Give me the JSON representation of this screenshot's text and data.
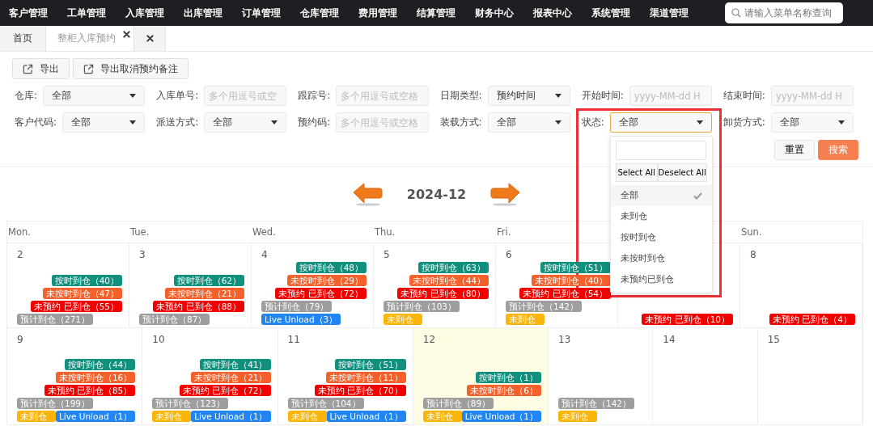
{
  "nav": {
    "items": [
      "客户管理",
      "工单管理",
      "入库管理",
      "出库管理",
      "订单管理",
      "仓库管理",
      "费用管理",
      "结算管理",
      "财务中心",
      "报表中心",
      "系统管理",
      "渠道管理"
    ],
    "search": {
      "placeholder": "请输入菜单名称查询"
    }
  },
  "tabs": [
    {
      "kind": "page",
      "label": "首页",
      "selected": false,
      "closable": false
    },
    {
      "kind": "page",
      "label": "整柜入库预约",
      "selected": true,
      "closable": true
    },
    {
      "kind": "close-all",
      "selected": false
    }
  ],
  "toolbar": [
    {
      "label": "导出"
    },
    {
      "label": "导出取消预约备注"
    }
  ],
  "filters": [
    [
      {
        "label": "仓库:",
        "kind": "select",
        "value": "全部",
        "focused": false
      },
      {
        "label": "入库单号:",
        "kind": "input",
        "placeholder": "多个用逗号或空",
        "focused": false
      },
      {
        "label": "跟踪号:",
        "kind": "input",
        "placeholder": "多个用逗号或空格",
        "focused": false
      },
      {
        "label": "日期类型:",
        "kind": "select",
        "value": "预约时间",
        "focused": false
      },
      {
        "label": "开始时间:",
        "kind": "input",
        "placeholder": "yyyy-MM-dd H",
        "focused": false
      },
      {
        "label": "结束时间:",
        "kind": "input",
        "placeholder": "yyyy-MM-dd H",
        "focused": false
      }
    ],
    [
      {
        "label": "客户代码:",
        "kind": "select",
        "value": "全部",
        "focused": false
      },
      {
        "label": "派送方式:",
        "kind": "select",
        "value": "全部",
        "focused": false
      },
      {
        "label": "预约码:",
        "kind": "input",
        "placeholder": "多个用逗号或空格",
        "focused": false
      },
      {
        "label": "装载方式:",
        "kind": "select",
        "value": "全部",
        "focused": false
      },
      {
        "label": "状态:",
        "kind": "select",
        "value": "全部",
        "focused": true
      },
      {
        "label": "卸货方式:",
        "kind": "select",
        "value": "全部",
        "focused": false
      }
    ]
  ],
  "actions": [
    {
      "label": "重置",
      "kind": "default"
    },
    {
      "label": "搜索",
      "kind": "primary"
    }
  ],
  "status_dropdown": {
    "actions": [
      "Select All",
      "Deselect All"
    ],
    "options": [
      {
        "label": "全部",
        "selected": true
      },
      {
        "label": "未到仓",
        "selected": false
      },
      {
        "label": "按时到仓",
        "selected": false
      },
      {
        "label": "未按时到仓",
        "selected": false
      },
      {
        "label": "未预约已到仓",
        "selected": false
      }
    ]
  },
  "calendar": {
    "title": "2024-12",
    "weekdays": {
      "mon": "Mon.",
      "tue": "Tue.",
      "wed": "Wed.",
      "thu": "Thu.",
      "fri": "Fri.",
      "sun": "Sun."
    },
    "weeks": [
      [
        {
          "day": "2",
          "today": false,
          "events": [
            {
              "kind": "ontime",
              "label": "按时到仓（40）"
            },
            {
              "kind": "late",
              "label": "未按时到仓（47）"
            },
            {
              "kind": "unscheduled",
              "label": "未预约 已到仓（55）"
            },
            {
              "kind": "expected",
              "label": "预计到仓（271）"
            }
          ]
        },
        {
          "day": "3",
          "today": false,
          "events": [
            {
              "kind": "ontime",
              "label": "按时到仓（62）"
            },
            {
              "kind": "late",
              "label": "未按时到仓（21）"
            },
            {
              "kind": "unscheduled",
              "label": "未预约 已到仓（88）"
            },
            {
              "kind": "expected",
              "label": "预计到仓（87）"
            }
          ]
        },
        {
          "day": "4",
          "today": false,
          "events": [
            {
              "kind": "ontime",
              "label": "按时到仓（48）"
            },
            {
              "kind": "late",
              "label": "未按时到仓（29）"
            },
            {
              "kind": "unscheduled",
              "label": "未预约 已到仓（72）"
            },
            {
              "kind": "expected",
              "label": "预计到仓（79）"
            },
            {
              "kind": "live",
              "label": "Live Unload（3）"
            }
          ]
        },
        {
          "day": "5",
          "today": false,
          "events": [
            {
              "kind": "ontime",
              "label": "按时到仓（63）"
            },
            {
              "kind": "late",
              "label": "未按时到仓（44）"
            },
            {
              "kind": "unscheduled",
              "label": "未预约 已到仓（80）"
            },
            {
              "kind": "expected",
              "label": "预计到仓（103）"
            },
            {
              "kind": "notarrived",
              "label": "未到仓"
            }
          ]
        },
        {
          "day": "6",
          "today": false,
          "events": [
            {
              "kind": "ontime",
              "label": "按时到仓（51）"
            },
            {
              "kind": "late",
              "label": "未按时到仓（40）"
            },
            {
              "kind": "unscheduled",
              "label": "未预约 已到仓（54）"
            },
            {
              "kind": "expected",
              "label": "预计到仓（142）"
            },
            {
              "kind": "notarrived",
              "label": "未到仓"
            }
          ]
        },
        {
          "today": false,
          "events": [
            {
              "kind": "unscheduled",
              "label": "未预约 已到仓（10）"
            }
          ]
        },
        {
          "day": "8",
          "today": false,
          "events": [
            {
              "kind": "unscheduled",
              "label": "未预约 已到仓（4）"
            }
          ]
        }
      ],
      [
        {
          "day": "9",
          "today": false,
          "events": [
            {
              "kind": "ontime",
              "label": "按时到仓（44）"
            },
            {
              "kind": "late",
              "label": "未按时到仓（16）"
            },
            {
              "kind": "unscheduled",
              "label": "未预约 已到仓（85）"
            },
            {
              "kind": "expected",
              "label": "预计到仓（199）"
            },
            {
              "kind": "notarrived",
              "label": "未到仓"
            },
            {
              "kind": "live",
              "label": "Live Unload（1）"
            }
          ]
        },
        {
          "day": "10",
          "today": false,
          "events": [
            {
              "kind": "ontime",
              "label": "按时到仓（41）"
            },
            {
              "kind": "late",
              "label": "未按时到仓（21）"
            },
            {
              "kind": "unscheduled",
              "label": "未预约 已到仓（72）"
            },
            {
              "kind": "expected",
              "label": "预计到仓（123）"
            },
            {
              "kind": "notarrived",
              "label": "未到仓"
            },
            {
              "kind": "live",
              "label": "Live Unload（1）"
            }
          ]
        },
        {
          "day": "11",
          "today": false,
          "events": [
            {
              "kind": "ontime",
              "label": "按时到仓（51）"
            },
            {
              "kind": "late",
              "label": "未按时到仓（11）"
            },
            {
              "kind": "unscheduled",
              "label": "未预约 已到仓（70）"
            },
            {
              "kind": "expected",
              "label": "预计到仓（104）"
            },
            {
              "kind": "notarrived",
              "label": "未到仓"
            },
            {
              "kind": "live",
              "label": "Live Unload（1）"
            }
          ]
        },
        {
          "day": "12",
          "today": true,
          "events": [
            {
              "kind": "ontime",
              "label": "按时到仓（1）"
            },
            {
              "kind": "late",
              "label": "未按时到仓（6）"
            },
            {
              "kind": "expected",
              "label": "预计到仓（89）"
            },
            {
              "kind": "notarrived",
              "label": "未到仓"
            },
            {
              "kind": "live",
              "label": "Live Unload（1）"
            }
          ]
        },
        {
          "day": "13",
          "today": false,
          "events": [
            {
              "kind": "expected",
              "label": "预计到仓（142）"
            },
            {
              "kind": "notarrived",
              "label": "未到仓"
            }
          ]
        },
        {
          "day": "14",
          "today": false
        },
        {
          "day": "15",
          "today": false
        }
      ]
    ]
  }
}
